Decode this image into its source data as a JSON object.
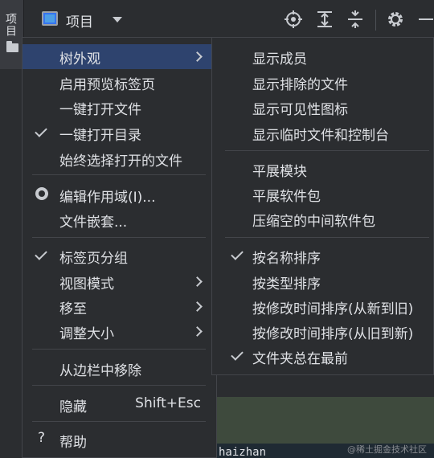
{
  "stripe": {
    "tab_label": "项目"
  },
  "toolbar": {
    "project_label": "项目",
    "icons": [
      "target-icon",
      "expand-all-icon",
      "collapse-all-icon",
      "gear-icon",
      "minimize-icon"
    ]
  },
  "menu": {
    "items": [
      {
        "label": "树外观",
        "submenu": true,
        "active": true
      },
      {
        "label": "启用预览标签页"
      },
      {
        "label": "一键打开文件"
      },
      {
        "label": "一键打开目录",
        "checked": true
      },
      {
        "label": "始终选择打开的文件"
      },
      {
        "label": "编辑作用域(I)...",
        "radio": true
      },
      {
        "label": "文件嵌套..."
      },
      {
        "label": "标签页分组",
        "checked": true
      },
      {
        "label": "视图模式",
        "submenu": true
      },
      {
        "label": "移至",
        "submenu": true
      },
      {
        "label": "调整大小",
        "submenu": true
      },
      {
        "label": "从边栏中移除"
      },
      {
        "label": "隐藏",
        "shortcut": "Shift+Esc"
      },
      {
        "label": "帮助",
        "icon": "?"
      }
    ]
  },
  "submenu": {
    "items": [
      {
        "label": "显示成员"
      },
      {
        "label": "显示排除的文件"
      },
      {
        "label": "显示可见性图标"
      },
      {
        "label": "显示临时文件和控制台"
      },
      {
        "label": "平展模块"
      },
      {
        "label": "平展软件包"
      },
      {
        "label": "压缩空的中间软件包"
      },
      {
        "label": "按名称排序",
        "checked": true
      },
      {
        "label": "按类型排序"
      },
      {
        "label": "按修改时间排序(从新到旧)"
      },
      {
        "label": "按修改时间排序(从旧到新)"
      },
      {
        "label": "文件夹总在最前",
        "checked": true
      }
    ]
  },
  "editor": {
    "visible_text": "haizhan"
  },
  "watermark": "@稀土掘金技术社区",
  "colors": {
    "background": "#2b2d30",
    "selection": "#2e436e",
    "border": "#43454a",
    "text": "#dfe1e5"
  }
}
